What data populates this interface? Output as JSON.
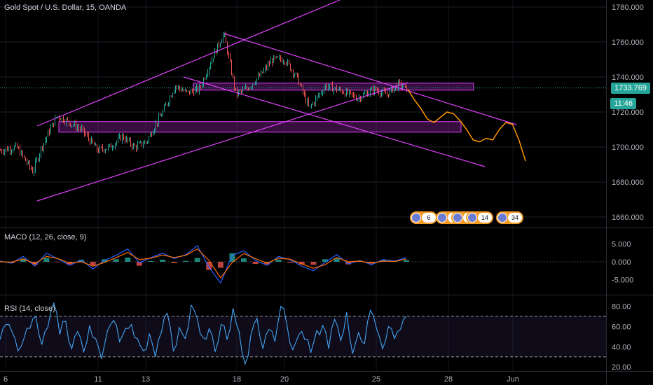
{
  "header": {
    "symbol_title": "Gold Spot / U.S. Dollar, 15, OANDA"
  },
  "price_badge": {
    "value": "1733.769",
    "countdown": "11:46",
    "color": "#26a69a"
  },
  "events": [
    {
      "count": "6",
      "icon": "us-flag-icon"
    },
    {
      "count": "5",
      "icon": "us-flag-icon"
    },
    {
      "count": "8",
      "icon": "us-flag-icon"
    },
    {
      "count": "14",
      "icon": "us-flag-icon"
    },
    {
      "count": "34",
      "icon": "us-flag-icon"
    }
  ],
  "colors": {
    "background": "#000000",
    "line_tools": "#e040fb",
    "up_candle": "#26a69a",
    "down_candle": "#ef5350",
    "projection": "#ff9800",
    "macd_line": "#2962ff",
    "signal_line": "#ff6d00",
    "rsi_line": "#7e57c2",
    "rsi_line_visible": "#42a5f5",
    "rsi_band": "#7e57c2",
    "grid": "#1e222d"
  },
  "chart_data": [
    {
      "type": "candlestick",
      "title": "Gold Spot / U.S. Dollar, 15, OANDA",
      "x_tick_labels": [
        "6",
        "11",
        "13",
        "18",
        "20",
        "25",
        "28",
        "Jun"
      ],
      "y_tick_labels": [
        "1780.000",
        "1760.000",
        "1740.000",
        "1720.000",
        "1700.000",
        "1680.000",
        "1660.000"
      ],
      "ylim": [
        1654,
        1784
      ],
      "last_price": 1733.769,
      "close_path": {
        "x": [
          0,
          4,
          8,
          10,
          12,
          14,
          17,
          20,
          24,
          27,
          30,
          33,
          36,
          38,
          40,
          43,
          46,
          49,
          52,
          55,
          58,
          61,
          64,
          67,
          70,
          73,
          76,
          80,
          84,
          88,
          92,
          95,
          98,
          100
        ],
        "y": [
          1698,
          1700,
          1686,
          1699,
          1709,
          1718,
          1714,
          1710,
          1698,
          1700,
          1706,
          1700,
          1703,
          1712,
          1720,
          1735,
          1731,
          1733,
          1750,
          1765,
          1730,
          1734,
          1741,
          1750,
          1750,
          1740,
          1722,
          1735,
          1732,
          1728,
          1733,
          1730,
          1736,
          1733
        ]
      },
      "channels": [
        {
          "name": "upper-rising-line",
          "x": [
            0,
            100
          ],
          "y": [
            1717,
            1805
          ]
        },
        {
          "name": "lower-rising-line",
          "x": [
            0,
            100
          ],
          "y": [
            1670,
            1752
          ]
        },
        {
          "name": "upper-falling-line",
          "x": [
            0,
            100
          ],
          "y": [
            1769,
            1715
          ]
        },
        {
          "name": "lower-falling-line",
          "x": [
            0,
            100
          ],
          "y": [
            1746,
            1691
          ]
        }
      ],
      "zones": [
        {
          "name": "upper-resistance-zone",
          "y": [
            1732.5,
            1736.5
          ]
        },
        {
          "name": "lower-support-zone",
          "y": [
            1708.5,
            1714.5
          ]
        }
      ],
      "projection_y": [
        1733,
        1727,
        1722,
        1716,
        1714,
        1717,
        1720,
        1719,
        1715,
        1710,
        1704,
        1703,
        1705,
        1704,
        1710,
        1714,
        1713,
        1704,
        1692
      ],
      "projection_end_label": "Jun"
    },
    {
      "type": "line",
      "title": "MACD (12, 26, close, 9)",
      "y_tick_labels": [
        "5.000",
        "0.000",
        "-5.000"
      ],
      "ylim": [
        -9,
        9
      ],
      "series": [
        {
          "values": [
            0.2,
            -0.4,
            1.5,
            -1.2,
            2.4,
            0.8,
            -1.0,
            0.5,
            -2.0,
            0.4,
            1.8,
            3.6,
            -0.3,
            1.2,
            2.4,
            0.9,
            2.0,
            4.5,
            -1.5,
            -5.9,
            1.8,
            3.1,
            0.4,
            -1.0,
            1.5,
            0.5,
            -1.2,
            -2.5,
            -0.2,
            2.0,
            -0.6,
            0.4,
            -0.8,
            0.6,
            0.2,
            1.2
          ]
        },
        {
          "values": [
            0.0,
            -0.1,
            0.8,
            -0.5,
            1.5,
            0.9,
            -0.4,
            0.0,
            -1.2,
            -0.2,
            1.2,
            2.6,
            0.6,
            1.0,
            1.9,
            1.2,
            1.8,
            3.6,
            0.4,
            -4.5,
            -0.2,
            2.3,
            0.9,
            -0.4,
            1.0,
            0.7,
            -0.6,
            -1.8,
            -0.8,
            1.2,
            0.0,
            0.2,
            -0.4,
            0.2,
            0.1,
            0.8
          ]
        }
      ]
    },
    {
      "type": "line",
      "title": "RSI (14, close)",
      "y_tick_labels": [
        "80.00",
        "60.00",
        "40.00",
        "20.00"
      ],
      "ylim": [
        16,
        90
      ],
      "bands": [
        30,
        70
      ],
      "series": [
        {
          "values": [
            47,
            62,
            55,
            36,
            48,
            58,
            70,
            42,
            59,
            83,
            52,
            65,
            38,
            55,
            35,
            61,
            48,
            28,
            56,
            66,
            45,
            58,
            62,
            48,
            36,
            53,
            30,
            54,
            73,
            36,
            59,
            48,
            81,
            68,
            49,
            58,
            35,
            62,
            47,
            78,
            55,
            23,
            52,
            68,
            38,
            57,
            45,
            80,
            62,
            37,
            52,
            47,
            34,
            56,
            61,
            38,
            67,
            46,
            74,
            33,
            54,
            43,
            76,
            58,
            38,
            60,
            48,
            57,
            70
          ]
        }
      ]
    }
  ]
}
